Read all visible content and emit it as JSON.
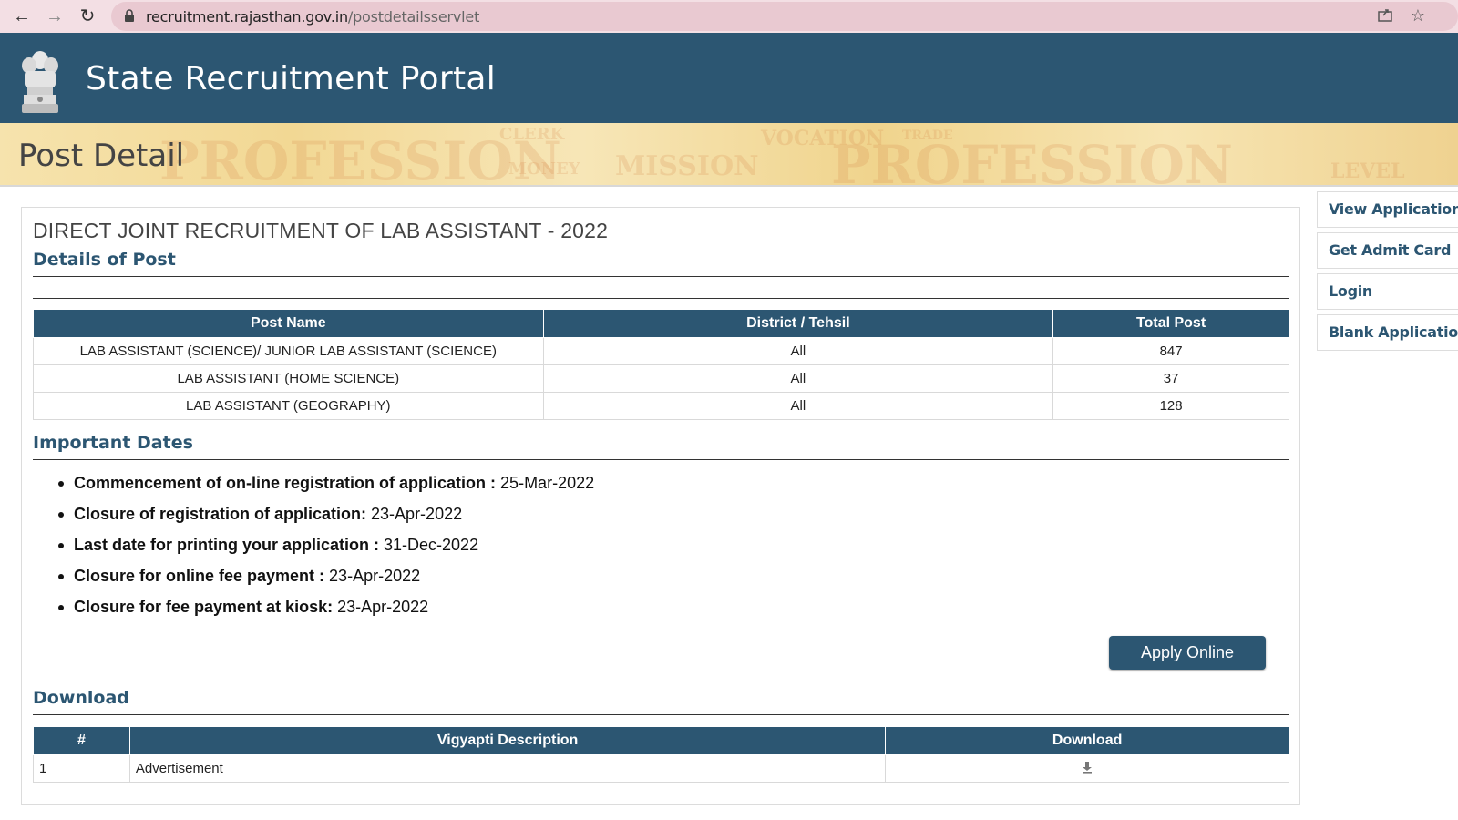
{
  "browser": {
    "url_domain": "recruitment.rajasthan.gov.in",
    "url_path": "/postdetailsservlet"
  },
  "header": {
    "site_title": "State Recruitment Portal"
  },
  "banner": {
    "title": "Post Detail",
    "words": [
      "PROFESSION",
      "CLERK",
      "MONEY",
      "MISSION",
      "VOCATION",
      "TRADE",
      "PROFESSION",
      "LEVEL"
    ]
  },
  "post": {
    "title": "DIRECT JOINT RECRUITMENT OF LAB ASSISTANT - 2022",
    "details_heading": "Details of Post",
    "table": {
      "headers": [
        "Post Name",
        "District / Tehsil",
        "Total Post"
      ],
      "rows": [
        [
          "LAB ASSISTANT (SCIENCE)/ JUNIOR LAB ASSISTANT (SCIENCE)",
          "All",
          "847"
        ],
        [
          "LAB ASSISTANT (HOME SCIENCE)",
          "All",
          "37"
        ],
        [
          "LAB ASSISTANT (GEOGRAPHY)",
          "All",
          "128"
        ]
      ]
    }
  },
  "dates": {
    "heading": "Important Dates",
    "items": [
      {
        "label": "Commencement of on-line registration of application :",
        "value": " 25-Mar-2022"
      },
      {
        "label": "Closure of registration of application:",
        "value": " 23-Apr-2022"
      },
      {
        "label": "Last date for printing your application :",
        "value": " 31-Dec-2022"
      },
      {
        "label": "Closure for online fee payment :",
        "value": " 23-Apr-2022"
      },
      {
        "label": "Closure for fee payment at kiosk:",
        "value": " 23-Apr-2022"
      }
    ]
  },
  "apply_button": "Apply Online",
  "download": {
    "heading": "Download",
    "headers": [
      "#",
      "Vigyapti Description",
      "Download"
    ],
    "rows": [
      {
        "index": "1",
        "description": "Advertisement"
      }
    ]
  },
  "sidebar": {
    "items": [
      "View Application",
      "Get Admit Card",
      "Login",
      "Blank Application"
    ]
  },
  "colors": {
    "primary": "#2c5672",
    "browser_bar": "#f3dfe4"
  }
}
